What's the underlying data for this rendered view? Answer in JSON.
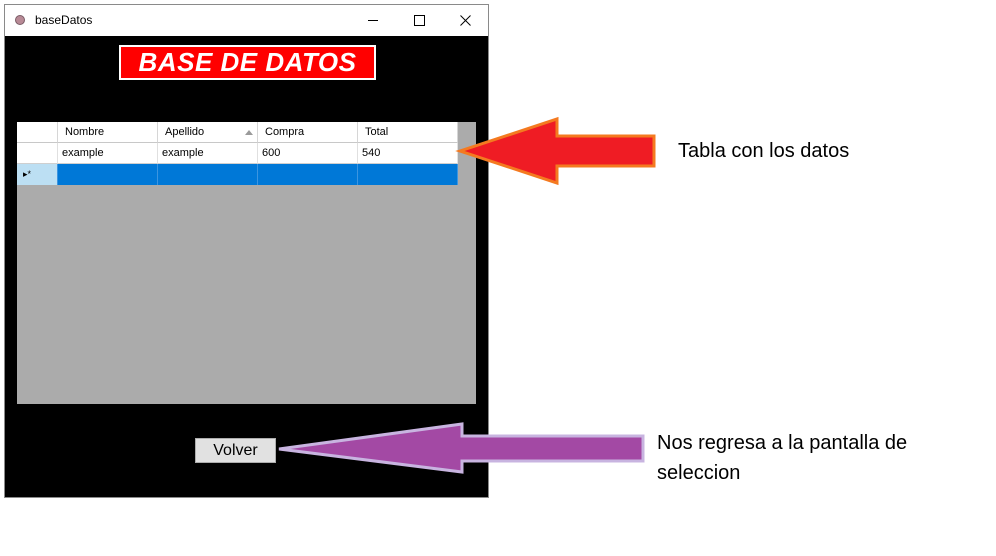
{
  "window": {
    "title": "baseDatos"
  },
  "banner": {
    "text": "BASE DE DATOS"
  },
  "table": {
    "columns": [
      "Nombre",
      "Apellido",
      "Compra",
      "Total"
    ],
    "sorted_column": "Apellido",
    "rows": [
      {
        "nombre": "example",
        "apellido": "example",
        "compra": "600",
        "total": "540"
      }
    ],
    "new_row_indicator": "▸*"
  },
  "buttons": {
    "volver": "Volver"
  },
  "annotations": {
    "table_note": "Tabla con los datos",
    "volver_note_line1": "Nos regresa a la pantalla de",
    "volver_note_line2": "seleccion"
  },
  "colors": {
    "banner": "#ff0000",
    "red_arrow": "#ef1c24",
    "red_arrow_outline": "#f47a20",
    "purple_arrow": "#a349a4",
    "purple_arrow_outline": "#c8b4e0",
    "selected_row": "#0078d7"
  }
}
